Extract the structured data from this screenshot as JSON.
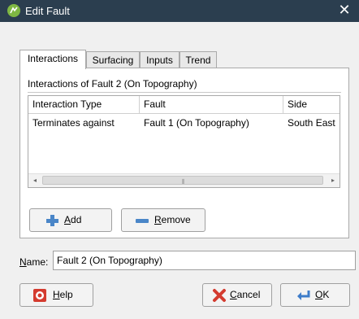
{
  "window": {
    "title": "Edit Fault",
    "close_glyph": "✕"
  },
  "tabs": [
    {
      "label": "Interactions",
      "active": true
    },
    {
      "label": "Surfacing",
      "active": false
    },
    {
      "label": "Inputs",
      "active": false
    },
    {
      "label": "Trend",
      "active": false
    }
  ],
  "interactions": {
    "group_label": "Interactions of Fault 2 (On Topography)",
    "columns": [
      "Interaction Type",
      "Fault",
      "Side"
    ],
    "rows": [
      [
        "Terminates against",
        "Fault 1 (On Topography)",
        "South East"
      ]
    ],
    "add_label": "Add",
    "add_underline": "A",
    "remove_label": "Remove",
    "remove_underline": "R"
  },
  "name": {
    "label": "Name:",
    "underline": "N",
    "value": "Fault 2 (On Topography)"
  },
  "footer": {
    "help_label": "Help",
    "cancel_label": "Cancel",
    "ok_label": "OK"
  },
  "colors": {
    "titlebar": "#2b3e4f",
    "app_icon": "#7fb843",
    "add_icon": "#4a86c8",
    "cancel_icon": "#d43b2f",
    "ok_icon": "#3d7cc9"
  }
}
